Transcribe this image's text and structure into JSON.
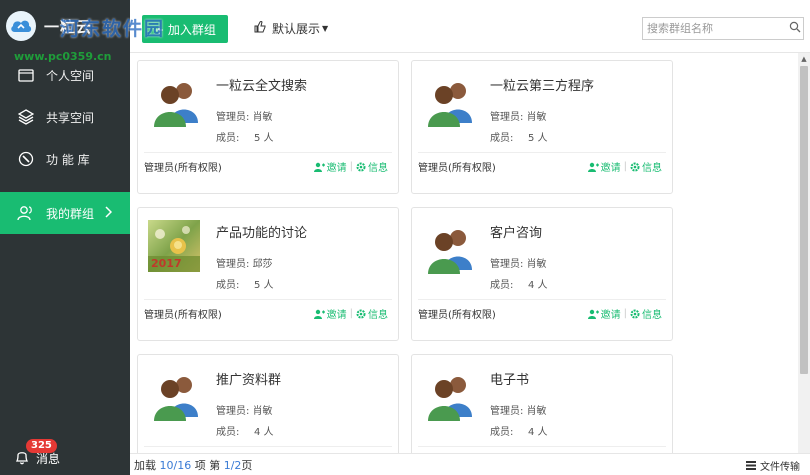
{
  "sidebar": {
    "logo_text": "一粒云",
    "items": [
      {
        "label": "个人空间",
        "icon": "folder-icon",
        "active": false
      },
      {
        "label": "共享空间",
        "icon": "layers-icon",
        "active": false
      },
      {
        "label": "功 能 库",
        "icon": "compass-icon",
        "active": false
      },
      {
        "label": "我的群组",
        "icon": "user-group-icon",
        "active": true
      }
    ],
    "notifications": {
      "count": "325",
      "label": "消息"
    }
  },
  "header": {
    "join_button": "+ 加入群组",
    "display_mode": "默认展示",
    "search_placeholder": "搜索群组名称"
  },
  "watermark": {
    "title": "河东软件园",
    "url": "www.pc0359.cn"
  },
  "cards": [
    {
      "name": "一粒云全文搜索",
      "manager_label": "管理员:",
      "manager": "肖敏",
      "members_label": "成员:",
      "members": "5 人",
      "role": "管理员(所有权限)",
      "invite": "邀请",
      "info": "信息",
      "avatar": "group-avatar"
    },
    {
      "name": "一粒云第三方程序",
      "manager_label": "管理员:",
      "manager": "肖敏",
      "members_label": "成员:",
      "members": "5 人",
      "role": "管理员(所有权限)",
      "invite": "邀请",
      "info": "信息",
      "avatar": "group-avatar"
    },
    {
      "name": "产品功能的讨论",
      "manager_label": "管理员:",
      "manager": "邱莎",
      "members_label": "成员:",
      "members": "5 人",
      "role": "管理员(所有权限)",
      "invite": "邀请",
      "info": "信息",
      "avatar": "photo-avatar",
      "photo_text": "2017"
    },
    {
      "name": "客户咨询",
      "manager_label": "管理员:",
      "manager": "肖敏",
      "members_label": "成员:",
      "members": "4 人",
      "role": "管理员(所有权限)",
      "invite": "邀请",
      "info": "信息",
      "avatar": "group-avatar"
    },
    {
      "name": "推广资料群",
      "manager_label": "管理员:",
      "manager": "肖敏",
      "members_label": "成员:",
      "members": "4 人",
      "role": "",
      "invite": "",
      "info": "",
      "avatar": "group-avatar"
    },
    {
      "name": "电子书",
      "manager_label": "管理员:",
      "manager": "肖敏",
      "members_label": "成员:",
      "members": "4 人",
      "role": "",
      "invite": "",
      "info": "",
      "avatar": "group-avatar"
    }
  ],
  "footer": {
    "prefix": "加载 ",
    "loaded": "10/16",
    "middle": " 项 第 ",
    "page": "1/2",
    "suffix": "页",
    "transfer": "文件传输"
  },
  "colors": {
    "accent": "#19bc72",
    "sidebar_bg": "#2d3436",
    "badge": "#e53935"
  }
}
